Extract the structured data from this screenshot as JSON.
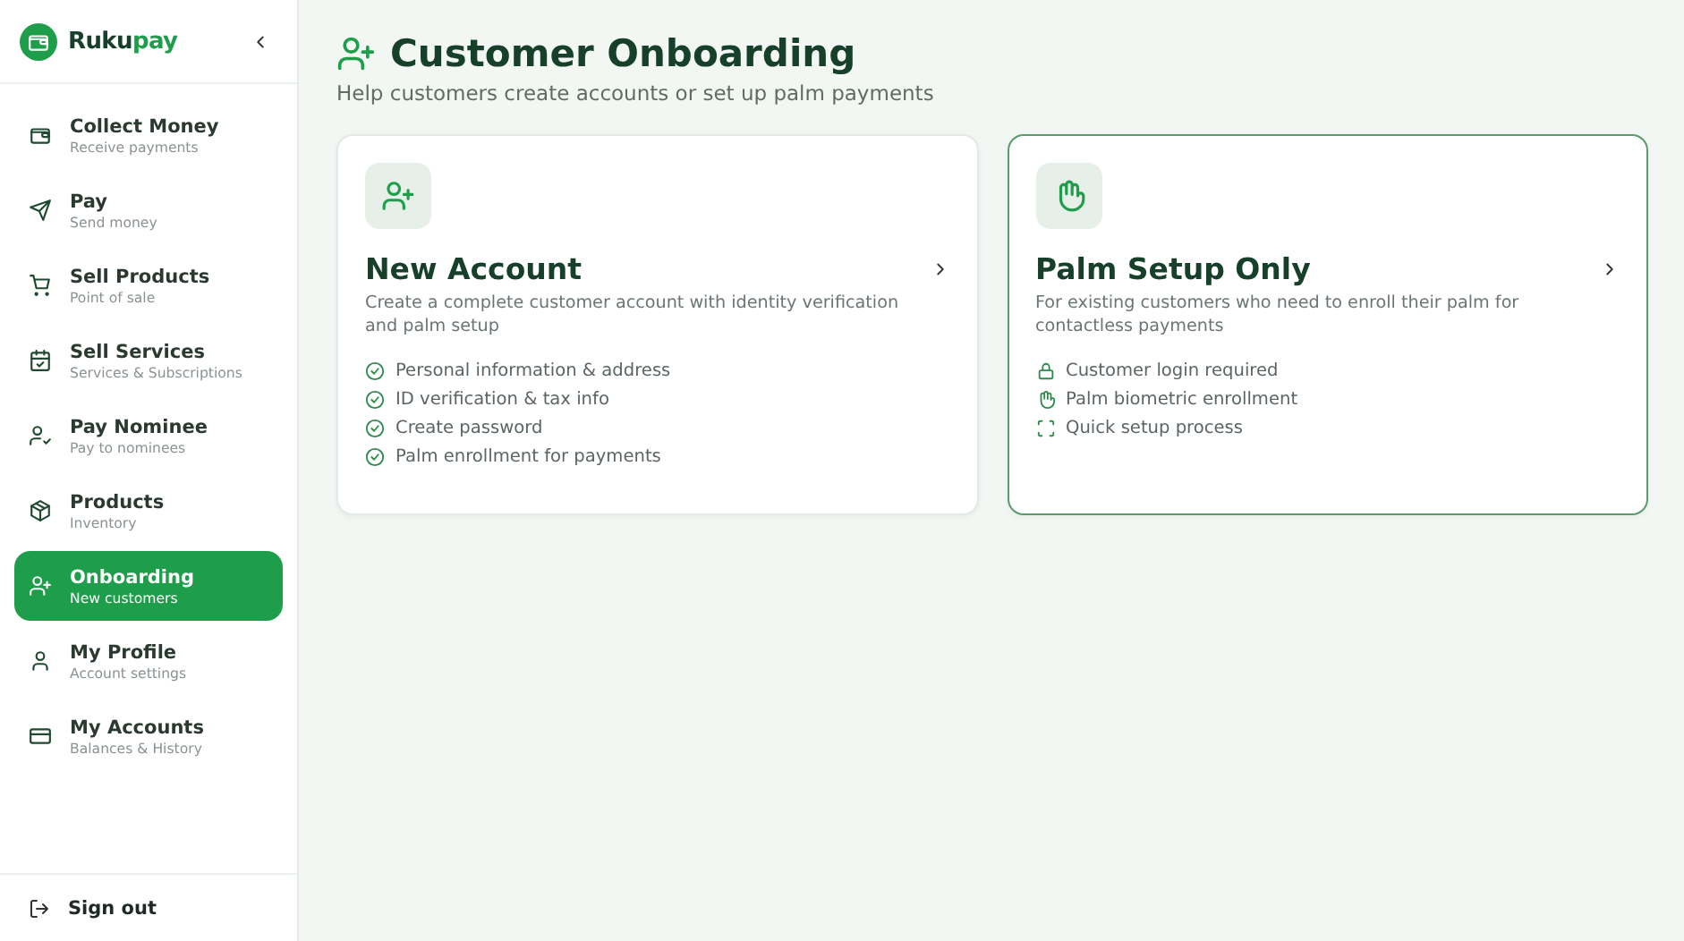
{
  "brand": {
    "name": "Ruku",
    "accent": "pay"
  },
  "sidebar": {
    "items": [
      {
        "kind": "wallet",
        "label": "Collect Money",
        "sublabel": "Receive payments",
        "selected": false
      },
      {
        "kind": "send",
        "label": "Pay",
        "sublabel": "Send money",
        "selected": false
      },
      {
        "kind": "cart",
        "label": "Sell Products",
        "sublabel": "Point of sale",
        "selected": false
      },
      {
        "kind": "calendar",
        "label": "Sell Services",
        "sublabel": "Services & Subscriptions",
        "selected": false
      },
      {
        "kind": "nominee",
        "label": "Pay Nominee",
        "sublabel": "Pay to nominees",
        "selected": false
      },
      {
        "kind": "package",
        "label": "Products",
        "sublabel": "Inventory",
        "selected": false
      },
      {
        "kind": "onboarding",
        "label": "Onboarding",
        "sublabel": "New customers",
        "selected": true
      },
      {
        "kind": "profile",
        "label": "My Profile",
        "sublabel": "Account settings",
        "selected": false
      },
      {
        "kind": "accounts",
        "label": "My Accounts",
        "sublabel": "Balances & History",
        "selected": false
      }
    ],
    "sign_out": "Sign out"
  },
  "page": {
    "title": "Customer Onboarding",
    "subtitle": "Help customers create accounts or set up palm payments"
  },
  "cards": [
    {
      "kind": "account",
      "title": "New Account",
      "description": "Create a complete customer account with identity verification and palm setup",
      "selected": false,
      "features": [
        {
          "kind": "step",
          "text": "Personal information & address"
        },
        {
          "kind": "step",
          "text": "ID verification & tax info"
        },
        {
          "kind": "step",
          "text": "Create password"
        },
        {
          "kind": "step",
          "text": "Palm enrollment for payments"
        }
      ]
    },
    {
      "kind": "palm",
      "title": "Palm Setup Only",
      "description": "For existing customers who need to enroll their palm for contactless payments",
      "selected": true,
      "features": [
        {
          "kind": "login",
          "text": "Customer login required"
        },
        {
          "kind": "palm",
          "text": "Palm biometric enrollment"
        },
        {
          "kind": "quick",
          "text": "Quick setup process"
        }
      ]
    }
  ]
}
